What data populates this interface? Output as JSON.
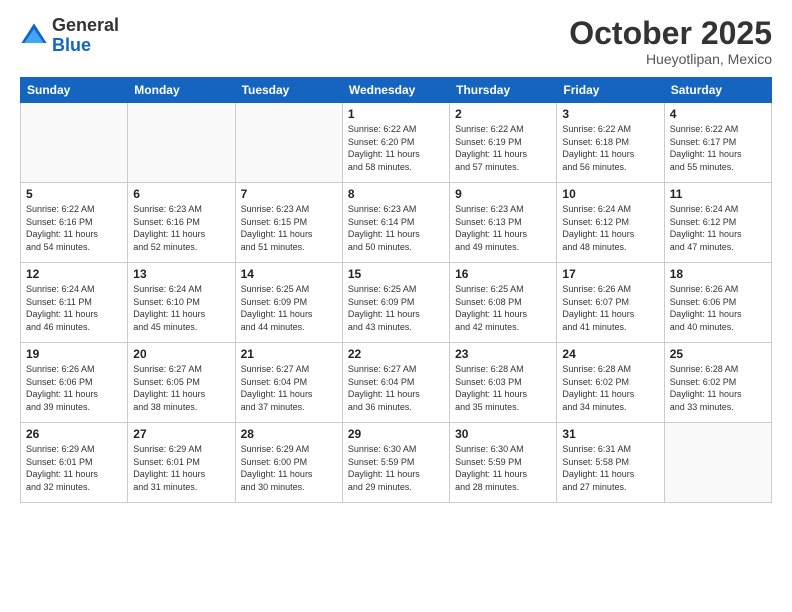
{
  "logo": {
    "general": "General",
    "blue": "Blue"
  },
  "header": {
    "month": "October 2025",
    "location": "Hueyotlipan, Mexico"
  },
  "days_of_week": [
    "Sunday",
    "Monday",
    "Tuesday",
    "Wednesday",
    "Thursday",
    "Friday",
    "Saturday"
  ],
  "weeks": [
    [
      {
        "day": "",
        "empty": true
      },
      {
        "day": "",
        "empty": true
      },
      {
        "day": "",
        "empty": true
      },
      {
        "day": "1",
        "sunrise": "6:22 AM",
        "sunset": "6:20 PM",
        "daylight": "11 hours and 58 minutes."
      },
      {
        "day": "2",
        "sunrise": "6:22 AM",
        "sunset": "6:19 PM",
        "daylight": "11 hours and 57 minutes."
      },
      {
        "day": "3",
        "sunrise": "6:22 AM",
        "sunset": "6:18 PM",
        "daylight": "11 hours and 56 minutes."
      },
      {
        "day": "4",
        "sunrise": "6:22 AM",
        "sunset": "6:17 PM",
        "daylight": "11 hours and 55 minutes."
      }
    ],
    [
      {
        "day": "5",
        "sunrise": "6:22 AM",
        "sunset": "6:16 PM",
        "daylight": "11 hours and 54 minutes."
      },
      {
        "day": "6",
        "sunrise": "6:23 AM",
        "sunset": "6:16 PM",
        "daylight": "11 hours and 52 minutes."
      },
      {
        "day": "7",
        "sunrise": "6:23 AM",
        "sunset": "6:15 PM",
        "daylight": "11 hours and 51 minutes."
      },
      {
        "day": "8",
        "sunrise": "6:23 AM",
        "sunset": "6:14 PM",
        "daylight": "11 hours and 50 minutes."
      },
      {
        "day": "9",
        "sunrise": "6:23 AM",
        "sunset": "6:13 PM",
        "daylight": "11 hours and 49 minutes."
      },
      {
        "day": "10",
        "sunrise": "6:24 AM",
        "sunset": "6:12 PM",
        "daylight": "11 hours and 48 minutes."
      },
      {
        "day": "11",
        "sunrise": "6:24 AM",
        "sunset": "6:12 PM",
        "daylight": "11 hours and 47 minutes."
      }
    ],
    [
      {
        "day": "12",
        "sunrise": "6:24 AM",
        "sunset": "6:11 PM",
        "daylight": "11 hours and 46 minutes."
      },
      {
        "day": "13",
        "sunrise": "6:24 AM",
        "sunset": "6:10 PM",
        "daylight": "11 hours and 45 minutes."
      },
      {
        "day": "14",
        "sunrise": "6:25 AM",
        "sunset": "6:09 PM",
        "daylight": "11 hours and 44 minutes."
      },
      {
        "day": "15",
        "sunrise": "6:25 AM",
        "sunset": "6:09 PM",
        "daylight": "11 hours and 43 minutes."
      },
      {
        "day": "16",
        "sunrise": "6:25 AM",
        "sunset": "6:08 PM",
        "daylight": "11 hours and 42 minutes."
      },
      {
        "day": "17",
        "sunrise": "6:26 AM",
        "sunset": "6:07 PM",
        "daylight": "11 hours and 41 minutes."
      },
      {
        "day": "18",
        "sunrise": "6:26 AM",
        "sunset": "6:06 PM",
        "daylight": "11 hours and 40 minutes."
      }
    ],
    [
      {
        "day": "19",
        "sunrise": "6:26 AM",
        "sunset": "6:06 PM",
        "daylight": "11 hours and 39 minutes."
      },
      {
        "day": "20",
        "sunrise": "6:27 AM",
        "sunset": "6:05 PM",
        "daylight": "11 hours and 38 minutes."
      },
      {
        "day": "21",
        "sunrise": "6:27 AM",
        "sunset": "6:04 PM",
        "daylight": "11 hours and 37 minutes."
      },
      {
        "day": "22",
        "sunrise": "6:27 AM",
        "sunset": "6:04 PM",
        "daylight": "11 hours and 36 minutes."
      },
      {
        "day": "23",
        "sunrise": "6:28 AM",
        "sunset": "6:03 PM",
        "daylight": "11 hours and 35 minutes."
      },
      {
        "day": "24",
        "sunrise": "6:28 AM",
        "sunset": "6:02 PM",
        "daylight": "11 hours and 34 minutes."
      },
      {
        "day": "25",
        "sunrise": "6:28 AM",
        "sunset": "6:02 PM",
        "daylight": "11 hours and 33 minutes."
      }
    ],
    [
      {
        "day": "26",
        "sunrise": "6:29 AM",
        "sunset": "6:01 PM",
        "daylight": "11 hours and 32 minutes."
      },
      {
        "day": "27",
        "sunrise": "6:29 AM",
        "sunset": "6:01 PM",
        "daylight": "11 hours and 31 minutes."
      },
      {
        "day": "28",
        "sunrise": "6:29 AM",
        "sunset": "6:00 PM",
        "daylight": "11 hours and 30 minutes."
      },
      {
        "day": "29",
        "sunrise": "6:30 AM",
        "sunset": "5:59 PM",
        "daylight": "11 hours and 29 minutes."
      },
      {
        "day": "30",
        "sunrise": "6:30 AM",
        "sunset": "5:59 PM",
        "daylight": "11 hours and 28 minutes."
      },
      {
        "day": "31",
        "sunrise": "6:31 AM",
        "sunset": "5:58 PM",
        "daylight": "11 hours and 27 minutes."
      },
      {
        "day": "",
        "empty": true
      }
    ]
  ],
  "labels": {
    "sunrise": "Sunrise:",
    "sunset": "Sunset:",
    "daylight": "Daylight:"
  }
}
